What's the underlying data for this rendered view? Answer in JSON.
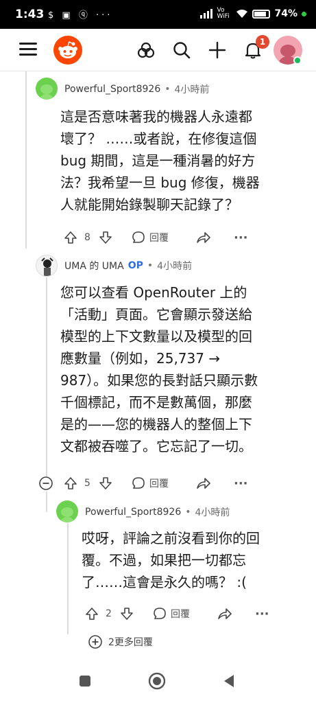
{
  "status_bar": {
    "time": "1:43",
    "notif_icons": "$ ▣ ⓠ ···",
    "network": "Vo WiFi",
    "battery": "74%"
  },
  "header": {
    "icons": [
      "menu-icon",
      "reddit-logo",
      "communities-icon",
      "search-icon",
      "create-icon",
      "notifications-icon",
      "user-avatar"
    ],
    "notification_count": "1",
    "accent": "#ff4500"
  },
  "comments": [
    {
      "author": "Powerful_Sport8926",
      "op": "",
      "time": "4小時前",
      "lines": [
        "這是否意味著我的機器人永遠都",
        "壞了？ ……或者說，在修復這個",
        "bug 期間，這是一種消暑的好方",
        "法？我希望一旦 bug 修復，機器",
        "人就能開始錄製聊天記錄了？"
      ],
      "votes": "8",
      "reply_label": "回覆",
      "share_icon": "share-icon",
      "more_icon": "more-icon"
    },
    {
      "author": "UMA 的 UMA",
      "op": "OP",
      "time": "4小時前",
      "lines": [
        "您可以查看 OpenRouter 上的",
        "「活動」頁面。它會顯示發送給",
        "模型的上下文數量以及模型的回",
        "應數量（例如，25,737 →",
        "987）。如果您的長對話只顯示數",
        "千個標記，而不是數萬個，那麼",
        "是的——您的機器人的整個上下",
        "文都被吞噬了。它忘記了一切。"
      ],
      "votes": "5",
      "reply_label": "回覆",
      "share_icon": "share-icon",
      "more_icon": "more-icon"
    },
    {
      "author": "Powerful_Sport8926",
      "op": "",
      "time": "4小時前",
      "lines": [
        "哎呀，評論之前沒看到你的回",
        "覆。不過，如果把一切都忘",
        "了……這會是永久的嗎？ :("
      ],
      "votes": "2",
      "reply_label": "回覆",
      "share_icon": "share-icon",
      "more_icon": "more-icon"
    }
  ],
  "more_replies": "2更多回覆",
  "nav": [
    "recents-button",
    "home-button",
    "back-button"
  ]
}
